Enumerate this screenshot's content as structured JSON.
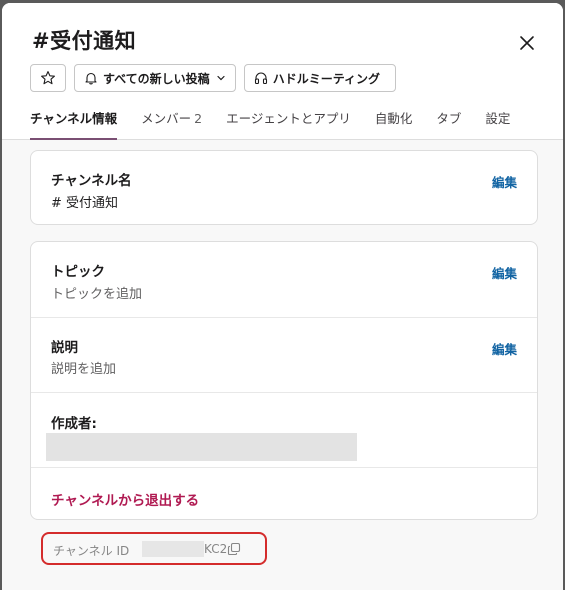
{
  "modal": {
    "title": "#受付通知"
  },
  "actions": {
    "star_icon": "star-icon",
    "notifications_label": "すべての新しい投稿",
    "huddle_label": "ハドルミーティング"
  },
  "tabs": [
    {
      "label": "チャンネル情報",
      "active": true
    },
    {
      "label": "メンバー",
      "count": "2"
    },
    {
      "label": "エージェントとアプリ"
    },
    {
      "label": "自動化"
    },
    {
      "label": "タブ"
    },
    {
      "label": "設定"
    }
  ],
  "channel_name": {
    "title": "チャンネル名",
    "value": "# 受付通知",
    "edit": "編集"
  },
  "topic": {
    "title": "トピック",
    "value": "トピックを追加",
    "edit": "編集"
  },
  "description": {
    "title": "説明",
    "value": "説明を追加",
    "edit": "編集"
  },
  "creator": {
    "title": "作成者:"
  },
  "leave": {
    "label": "チャンネルから退出する"
  },
  "channel_id": {
    "label": "チャンネル ID",
    "visible_suffix": "KC2"
  },
  "colors": {
    "accent_tab": "#7a4f73",
    "link": "#1264a3",
    "danger": "#b01a52",
    "highlight_box": "#d42c2c"
  }
}
